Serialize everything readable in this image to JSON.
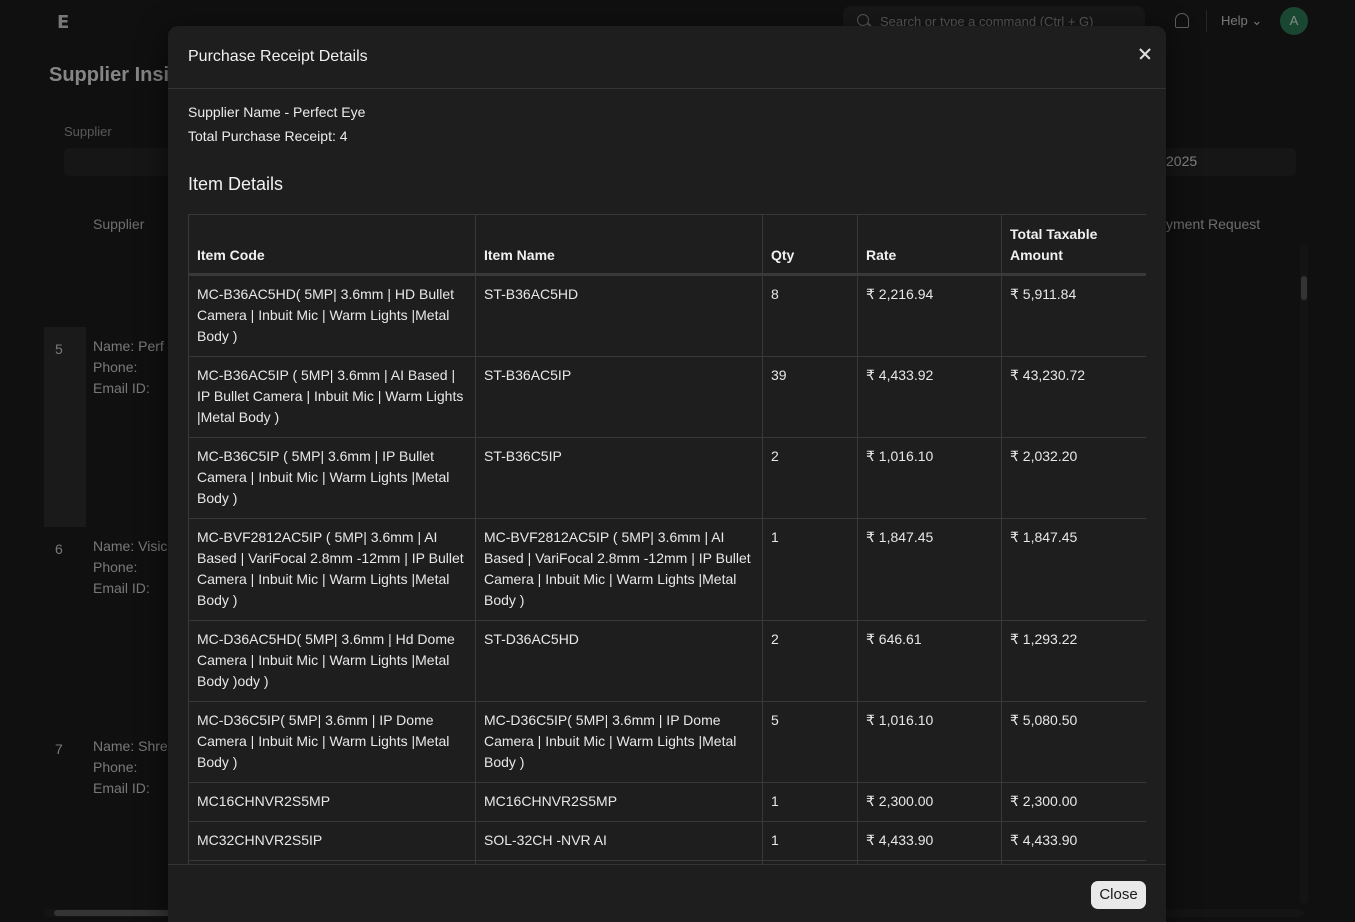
{
  "navbar": {
    "logo": "E",
    "search_placeholder": "Search or type a command (Ctrl + G)",
    "help_label": "Help",
    "avatar_initial": "A"
  },
  "background": {
    "title": "Supplier Insi",
    "filter_label": "Supplier",
    "year_value": "2025",
    "column_supplier": "Supplier",
    "column_payment": "yment Request",
    "rows": [
      {
        "num": "5",
        "name": "Name: Perf",
        "phone": "Phone:",
        "email": "Email ID:"
      },
      {
        "num": "6",
        "name": "Name: Visic",
        "phone": "Phone:",
        "email": "Email ID:"
      },
      {
        "num": "7",
        "name": "Name: Shre",
        "phone": "Phone:",
        "email": "Email ID:"
      }
    ]
  },
  "modal": {
    "title": "Purchase Receipt Details",
    "supplier_line": "Supplier Name - Perfect Eye",
    "total_line": "Total Purchase Receipt: 4",
    "section_title": "Item Details",
    "close_button": "Close",
    "table": {
      "headers": [
        "Item Code",
        "Item Name",
        "Qty",
        "Rate",
        "Total Taxable Amount"
      ],
      "rows": [
        {
          "code": "MC-B36AC5HD( 5MP| 3.6mm | HD Bullet Camera | Inbuit Mic | Warm Lights |Metal Body )",
          "name": "ST-B36AC5HD",
          "qty": "8",
          "rate": "₹ 2,216.94",
          "amount": "₹ 5,911.84"
        },
        {
          "code": "MC-B36AC5IP ( 5MP| 3.6mm | AI Based | IP Bullet Camera | Inbuit Mic | Warm Lights |Metal Body )",
          "name": "ST-B36AC5IP",
          "qty": "39",
          "rate": "₹ 4,433.92",
          "amount": "₹ 43,230.72"
        },
        {
          "code": "MC-B36C5IP ( 5MP| 3.6mm | IP Bullet Camera | Inbuit Mic | Warm Lights |Metal Body )",
          "name": "ST-B36C5IP",
          "qty": "2",
          "rate": "₹ 1,016.10",
          "amount": "₹ 2,032.20"
        },
        {
          "code": "MC-BVF2812AC5IP ( 5MP| 3.6mm | AI Based | VariFocal 2.8mm -12mm | IP Bullet Camera | Inbuit Mic | Warm Lights |Metal Body )",
          "name": "MC-BVF2812AC5IP ( 5MP| 3.6mm | AI Based | VariFocal 2.8mm -12mm | IP Bullet Camera | Inbuit Mic | Warm Lights |Metal Body )",
          "qty": "1",
          "rate": "₹ 1,847.45",
          "amount": "₹ 1,847.45"
        },
        {
          "code": "MC-D36AC5HD( 5MP| 3.6mm | Hd Dome Camera | Inbuit Mic | Warm Lights |Metal Body )ody )",
          "name": "ST-D36AC5HD",
          "qty": "2",
          "rate": "₹ 646.61",
          "amount": "₹ 1,293.22"
        },
        {
          "code": "MC-D36C5IP( 5MP| 3.6mm | IP Dome Camera | Inbuit Mic | Warm Lights |Metal Body )",
          "name": "MC-D36C5IP( 5MP| 3.6mm | IP Dome Camera | Inbuit Mic | Warm Lights |Metal Body )",
          "qty": "5",
          "rate": "₹ 1,016.10",
          "amount": "₹ 5,080.50"
        },
        {
          "code": "MC16CHNVR2S5MP",
          "name": "MC16CHNVR2S5MP",
          "qty": "1",
          "rate": "₹ 2,300.00",
          "amount": "₹ 2,300.00"
        },
        {
          "code": "MC32CHNVR2S5IP",
          "name": "SOL-32CH -NVR AI",
          "qty": "1",
          "rate": "₹ 4,433.90",
          "amount": "₹ 4,433.90"
        }
      ]
    }
  }
}
